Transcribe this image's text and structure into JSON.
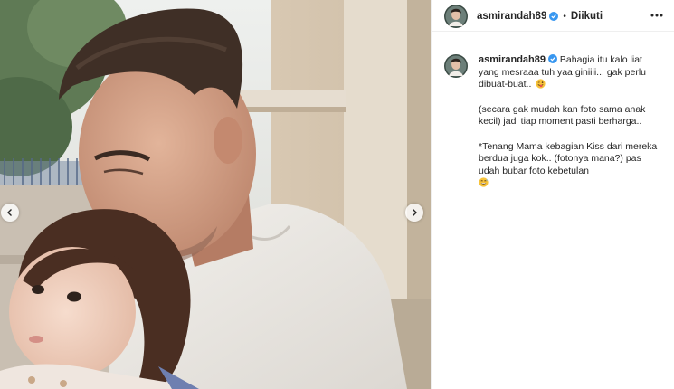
{
  "post": {
    "username": "asmirandah89",
    "dot": "•",
    "follow_state": "Diikuti",
    "caption": {
      "line1": "Bahagia itu kalo liat yang mesraaa tuh yaa giniiii... gak perlu dibuat-buat..",
      "line2": "(secara gak mudah kan foto sama anak kecil) jadi tiap moment pasti berharga..",
      "line3": "*Tenang Mama kebagian Kiss dari mereka berdua juga kok.. (fotonya mana?) pas udah bubar foto kebetulan"
    },
    "icons": {
      "verified": "verified-badge-icon",
      "more": "more-options-icon",
      "prev": "chevron-left-icon",
      "next": "chevron-right-icon",
      "emoji_tongue": "winking-tongue-emoji",
      "emoji_laugh": "grinning-sweat-emoji"
    },
    "colors": {
      "verified": "#3897f0",
      "text": "#262626",
      "border": "#efefef"
    }
  }
}
